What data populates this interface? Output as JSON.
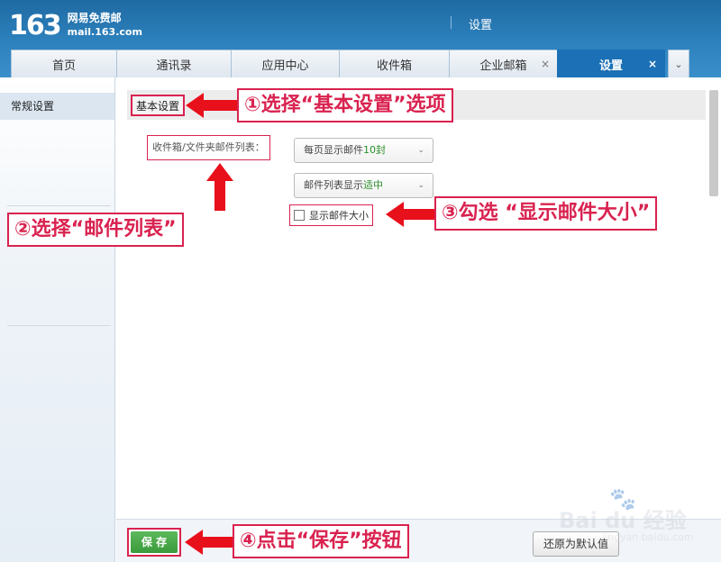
{
  "app": {
    "logo_number": "163",
    "logo_cn": "网易免费邮",
    "logo_domain": "mail.163.com",
    "header_title": "设置"
  },
  "tabs": [
    {
      "label": "首页"
    },
    {
      "label": "通讯录"
    },
    {
      "label": "应用中心"
    },
    {
      "label": "收件箱"
    },
    {
      "label": "企业邮箱",
      "close": "×"
    },
    {
      "label": "设置",
      "close": "×",
      "active": true
    }
  ],
  "sidebar": {
    "items": [
      {
        "label": "常规设置",
        "selected": true
      }
    ]
  },
  "settings": {
    "section_title": "基本设置",
    "field_label": "收件箱/文件夹邮件列表：",
    "per_page_select": {
      "prefix": "每页显示邮件",
      "value": "10封"
    },
    "display_select": {
      "prefix": "邮件列表显示",
      "value": "适中"
    },
    "show_size_checkbox": {
      "label": "显示邮件大小",
      "checked": false
    }
  },
  "callouts": {
    "step1": "①选择“基本设置”选项",
    "step2": "②选择“邮件列表”",
    "step3": "③勾选 “显示邮件大小”",
    "step4": "④点击“保存”按钮"
  },
  "footer": {
    "save_label": "保 存",
    "reset_label": "还原为默认值"
  },
  "watermark": {
    "text": "Bai du 经验",
    "url": "jingyan.baidu.com"
  },
  "colors": {
    "header": "#2d82be",
    "active_tab": "#1c70b5",
    "annotation": "#d9224f",
    "save_button": "#3b9a3b"
  }
}
